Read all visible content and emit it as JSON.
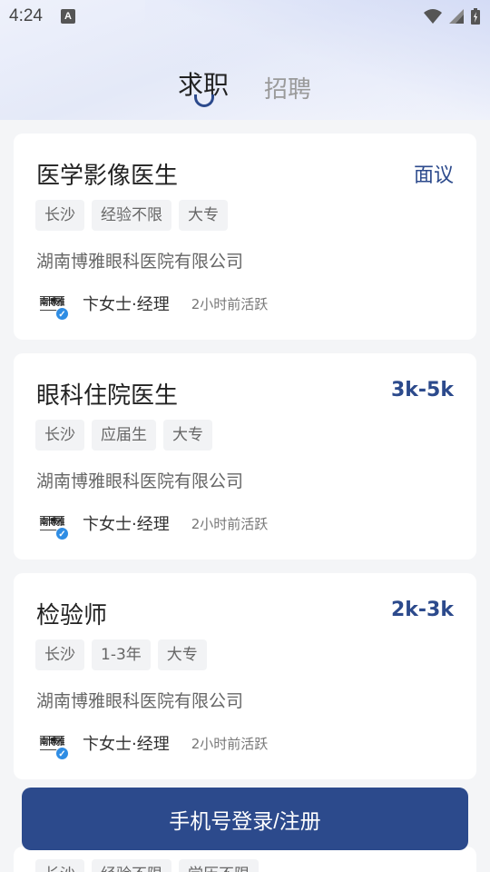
{
  "status_bar": {
    "time": "4:24",
    "notification_letter": "A"
  },
  "tabs": [
    {
      "label": "求职",
      "active": true
    },
    {
      "label": "招聘",
      "active": false
    }
  ],
  "jobs": [
    {
      "title": "医学影像医生",
      "salary": "面议",
      "tags": [
        "长沙",
        "经验不限",
        "大专"
      ],
      "company": "湖南博雅眼科医院有限公司",
      "recruiter": "卞女士·经理",
      "active_time": "2小时前活跃",
      "avatar_logo": "南博雅"
    },
    {
      "title": "眼科住院医生",
      "salary": "3k-5k",
      "tags": [
        "长沙",
        "应届生",
        "大专"
      ],
      "company": "湖南博雅眼科医院有限公司",
      "recruiter": "卞女士·经理",
      "active_time": "2小时前活跃",
      "avatar_logo": "南博雅"
    },
    {
      "title": "检验师",
      "salary": "2k-3k",
      "tags": [
        "长沙",
        "1-3年",
        "大专"
      ],
      "company": "湖南博雅眼科医院有限公司",
      "recruiter": "卞女士·经理",
      "active_time": "2小时前活跃",
      "avatar_logo": "南博雅"
    }
  ],
  "partial_job": {
    "tags": [
      "长沙",
      "经验不限",
      "学历不限"
    ]
  },
  "login_button": "手机号登录/注册",
  "colors": {
    "accent": "#2c4a8c",
    "verified_badge": "#2f8de4",
    "background": "#f4f5f7"
  }
}
